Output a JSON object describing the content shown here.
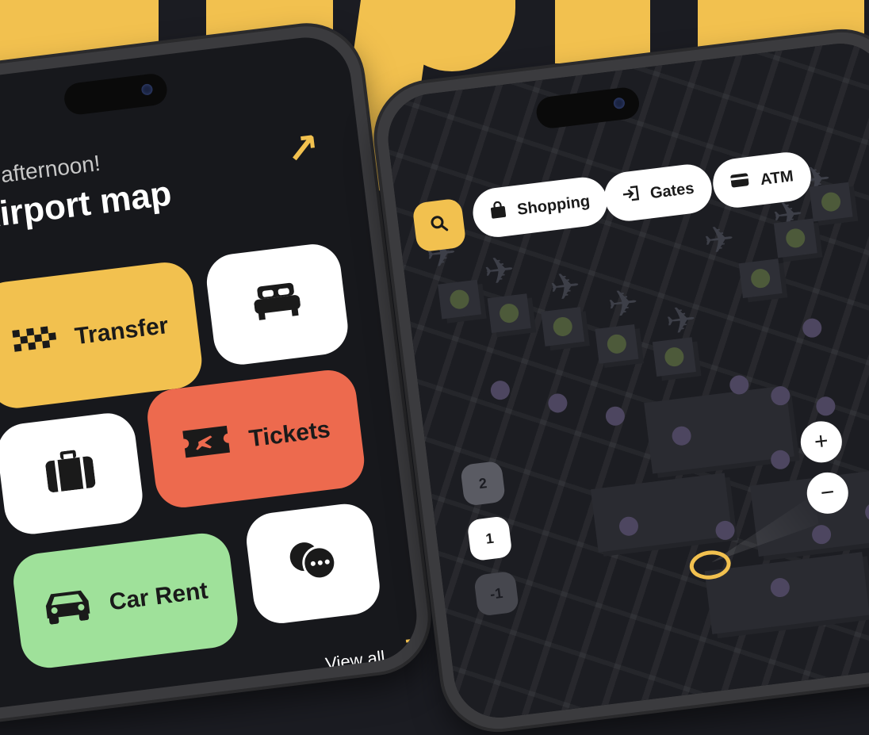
{
  "home": {
    "greeting": "od afternoon!",
    "title": "Airport map",
    "tiles": {
      "transfer": "Transfer",
      "tickets": "Tickets",
      "car_rent": "Car Rent"
    },
    "view_all": "View all"
  },
  "map": {
    "chips": {
      "shopping": "Shopping",
      "gates": "Gates",
      "atm": "ATM"
    },
    "floors": [
      "2",
      "1",
      "-1"
    ],
    "zoom": {
      "in": "+",
      "out": "−"
    }
  },
  "colors": {
    "accent": "#f2c14f",
    "tickets": "#ed6a4e",
    "car_rent": "#9fe19a",
    "background": "#1b1c22"
  }
}
